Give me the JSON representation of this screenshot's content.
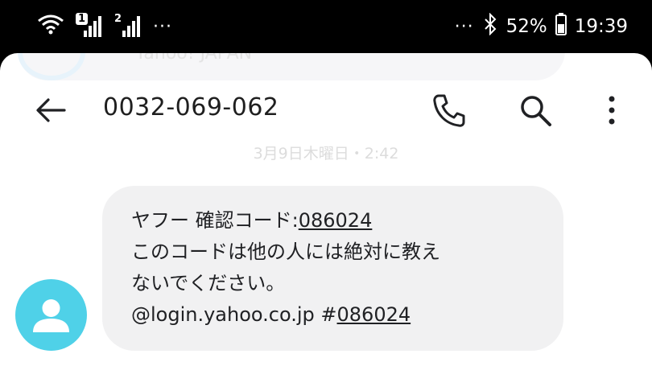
{
  "status_bar": {
    "sim1_label": "1",
    "sim2_label": "2",
    "left_overflow": "···",
    "right_overflow": "···",
    "battery_percent": "52%",
    "time": "19:39"
  },
  "header": {
    "sender": "0032-069-062"
  },
  "conversation": {
    "date_label": "3月9日木曜日・2:42",
    "ghost_text": "Yahoo! JAPAN",
    "message": {
      "line1_prefix": "ヤフー 確認コード:",
      "line1_code": "086024",
      "line2": "このコードは他の人には絶対に教え",
      "line3": "ないでください。",
      "line4_prefix": "@login.yahoo.co.jp #",
      "line4_code": "086024"
    }
  },
  "colors": {
    "avatar": "#4fd1e8",
    "bubble": "#f1f1f2",
    "statusbar": "#000000"
  }
}
